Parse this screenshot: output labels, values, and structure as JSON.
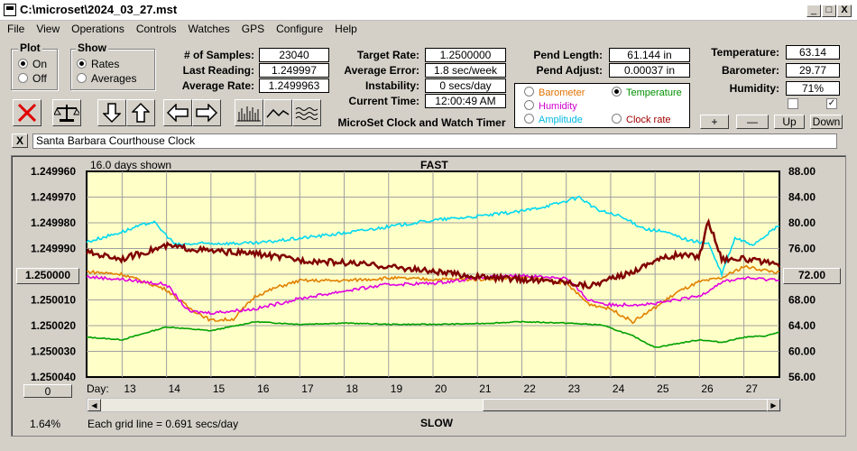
{
  "window": {
    "title": "C:\\microset\\2024_03_27.mst",
    "min": "_",
    "max": "□",
    "close": "X"
  },
  "menu": [
    "File",
    "View",
    "Operations",
    "Controls",
    "Watches",
    "GPS",
    "Configure",
    "Help"
  ],
  "plot": {
    "label": "Plot",
    "on": "On",
    "off": "Off",
    "selected": "On"
  },
  "show": {
    "label": "Show",
    "rates": "Rates",
    "averages": "Averages",
    "selected": "Rates"
  },
  "stats": {
    "samples_label": "# of Samples:",
    "samples": "23040",
    "last_label": "Last Reading:",
    "last": "1.249997",
    "avg_label": "Average Rate:",
    "avg": "1.2499963"
  },
  "rates": {
    "target_label": "Target Rate:",
    "target": "1.2500000",
    "error_label": "Average Error:",
    "error": "1.8 sec/week",
    "instab_label": "Instability:",
    "instab": "0 secs/day",
    "time_label": "Current Time:",
    "time": "12:00:49 AM"
  },
  "caption": "MicroSet Clock and Watch Timer",
  "pend": {
    "length_label": "Pend Length:",
    "length": "61.144 in",
    "adjust_label": "Pend Adjust:",
    "adjust": "0.00037 in"
  },
  "sources": {
    "barometer": "Barometer",
    "humidity": "Humidity",
    "amplitude": "Amplitude",
    "temperature": "Temperature",
    "clockrate": "Clock rate",
    "selected": "Temperature",
    "colors": {
      "barometer": "#e07000",
      "humidity": "#d000d0",
      "amplitude": "#00b8e0",
      "temperature": "#009000",
      "clockrate": "#a00000"
    }
  },
  "env": {
    "temp_label": "Temperature:",
    "temp": "63.14",
    "baro_label": "Barometer:",
    "baro": "29.77",
    "hum_label": "Humidity:",
    "hum": "71%"
  },
  "env_buttons": {
    "plus": "+",
    "minus": "—",
    "up": "Up",
    "down": "Down"
  },
  "env_checks": [
    false,
    true
  ],
  "watch_name": "Santa Barbara Courthouse Clock",
  "watch_close": "X",
  "chart": {
    "days_shown": "16.0 days shown",
    "fast": "FAST",
    "slow": "SLOW",
    "day_label": "Day:",
    "left_button": "1.250000",
    "right_button": "72.00",
    "zero_button": "0",
    "percent": "1.64%",
    "grid_note": "Each grid line = 0.691 secs/day"
  },
  "chart_data": {
    "type": "line",
    "title": "",
    "x_label": "Day:",
    "x_ticks": [
      13,
      14,
      15,
      16,
      17,
      18,
      19,
      20,
      21,
      22,
      23,
      24,
      25,
      26,
      27
    ],
    "x_range": [
      12.2,
      27.8
    ],
    "left_axis": {
      "ticks": [
        "1.249960",
        "1.249970",
        "1.249980",
        "1.249990",
        "1.250000",
        "1.250010",
        "1.250020",
        "1.250030",
        "1.250040"
      ],
      "range": [
        1.24996,
        1.25004
      ],
      "inverted": true
    },
    "right_axis": {
      "ticks": [
        "88.00",
        "84.00",
        "80.00",
        "76.00",
        "72.00",
        "68.00",
        "64.00",
        "60.00",
        "56.00"
      ],
      "range": [
        56,
        88
      ]
    },
    "background": "#ffffc8",
    "grid": true,
    "series": [
      {
        "name": "Temperature",
        "color": "#00a000",
        "axis": "right",
        "x": [
          12.2,
          13,
          14,
          15,
          16,
          17,
          18,
          19,
          20,
          21,
          22,
          23,
          23.8,
          24.5,
          25,
          25.5,
          26,
          26.5,
          27,
          27.5,
          27.8
        ],
        "y": [
          62.2,
          61.8,
          63.8,
          63.2,
          64.6,
          64.2,
          64.4,
          64.2,
          64.2,
          64.3,
          64.6,
          64.4,
          64.1,
          62.4,
          60.6,
          61.2,
          61.8,
          61.4,
          62.2,
          62.4,
          63.0
        ]
      },
      {
        "name": "Barometer",
        "color": "#e08000",
        "axis": "right",
        "x": [
          12.2,
          13,
          14,
          14.5,
          15,
          15.5,
          16,
          16.5,
          17,
          18,
          19,
          20,
          21,
          22,
          23,
          23.5,
          24,
          24.5,
          25,
          25.5,
          26,
          26.5,
          27,
          27.5,
          27.8
        ],
        "y": [
          72.4,
          72.0,
          69.6,
          66.8,
          64.8,
          65.0,
          68.6,
          70.0,
          71.0,
          71.0,
          71.4,
          71.2,
          71.2,
          71.6,
          70.6,
          67.4,
          66.6,
          64.6,
          66.8,
          69.2,
          70.8,
          71.4,
          73.2,
          72.6,
          72.2
        ]
      },
      {
        "name": "Humidity",
        "color": "#e000e0",
        "axis": "right",
        "x": [
          12.2,
          13,
          14,
          14.5,
          15,
          16,
          17,
          18,
          19,
          20,
          21,
          22,
          23,
          23.5,
          24,
          25,
          25.5,
          26,
          26.5,
          27,
          27.5,
          27.8
        ],
        "y": [
          71.6,
          71.2,
          70.4,
          66.2,
          66.0,
          66.6,
          68.2,
          69.4,
          70.4,
          70.6,
          71.4,
          71.8,
          71.4,
          68.0,
          67.2,
          67.4,
          68.0,
          68.6,
          70.8,
          71.4,
          71.2,
          71.2
        ]
      },
      {
        "name": "Amplitude",
        "color": "#00d8f0",
        "axis": "right",
        "x": [
          12.2,
          13,
          13.7,
          14.2,
          15,
          16,
          17,
          18,
          19,
          20,
          21,
          22,
          22.8,
          23.3,
          23.7,
          24.2,
          24.8,
          25.2,
          25.8,
          26.2,
          26.5,
          26.8,
          27.2,
          27.8
        ],
        "y": [
          77.0,
          78.6,
          80.2,
          76.6,
          76.8,
          76.8,
          77.6,
          78.4,
          79.4,
          80.4,
          81.0,
          81.8,
          83.0,
          84.0,
          82.0,
          81.0,
          79.0,
          78.6,
          77.2,
          76.8,
          72.0,
          77.6,
          76.6,
          79.6
        ]
      },
      {
        "name": "Clock rate",
        "color": "#800000",
        "axis": "right",
        "x": [
          12.2,
          13,
          14,
          15,
          16,
          17,
          18,
          19,
          20,
          21,
          22,
          23,
          23.5,
          24,
          24.5,
          25,
          25.5,
          26,
          26.2,
          26.5,
          27,
          27.5,
          27.8
        ],
        "y": [
          75.4,
          74.4,
          76.4,
          75.6,
          75.2,
          74.2,
          73.8,
          73.2,
          72.4,
          71.6,
          71.2,
          70.8,
          70.2,
          71.2,
          72.4,
          74.2,
          75.0,
          74.8,
          80.4,
          74.4,
          74.4,
          73.8,
          73.2
        ]
      }
    ]
  }
}
